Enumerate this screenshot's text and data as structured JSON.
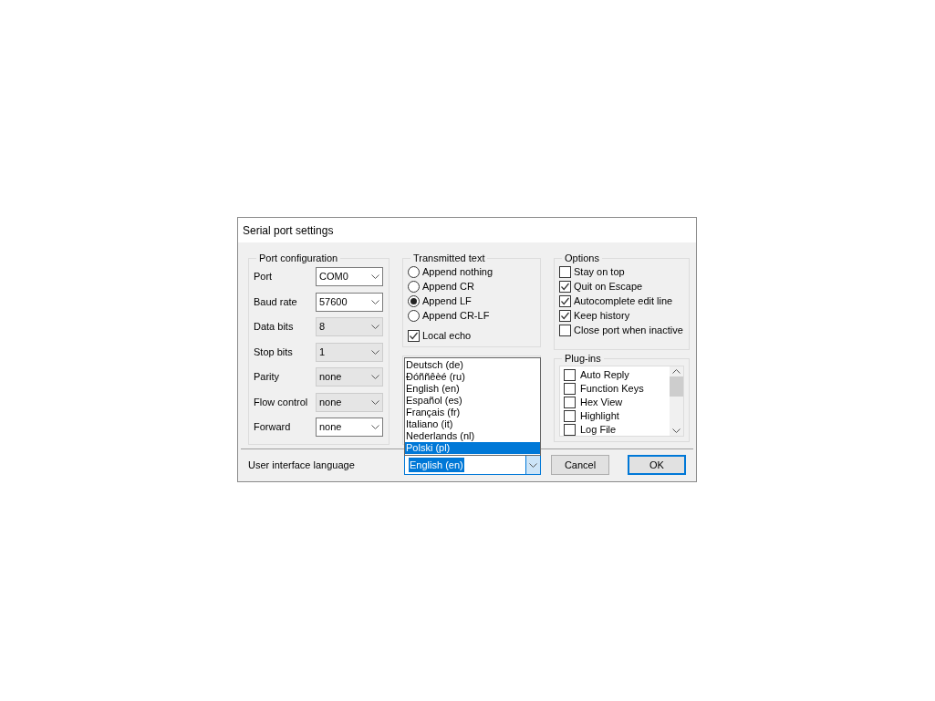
{
  "dialog": {
    "title": "Serial port settings"
  },
  "port_configuration": {
    "title": "Port configuration",
    "fields": [
      {
        "label": "Port",
        "value": "COM0",
        "disabled": false
      },
      {
        "label": "Baud rate",
        "value": "57600",
        "disabled": false
      },
      {
        "label": "Data bits",
        "value": "8",
        "disabled": true
      },
      {
        "label": "Stop bits",
        "value": "1",
        "disabled": true
      },
      {
        "label": "Parity",
        "value": "none",
        "disabled": true
      },
      {
        "label": "Flow control",
        "value": "none",
        "disabled": true
      },
      {
        "label": "Forward",
        "value": "none",
        "disabled": false
      }
    ]
  },
  "transmitted_text": {
    "title": "Transmitted text",
    "options": [
      {
        "label": "Append nothing",
        "selected": false
      },
      {
        "label": "Append CR",
        "selected": false
      },
      {
        "label": "Append LF",
        "selected": true
      },
      {
        "label": "Append CR-LF",
        "selected": false
      }
    ],
    "local_echo": {
      "label": "Local echo",
      "checked": true
    }
  },
  "options": {
    "title": "Options",
    "items": [
      {
        "label": "Stay on top",
        "checked": false
      },
      {
        "label": "Quit on Escape",
        "checked": true
      },
      {
        "label": "Autocomplete edit line",
        "checked": true
      },
      {
        "label": "Keep history",
        "checked": true
      },
      {
        "label": "Close port when inactive",
        "checked": false
      }
    ]
  },
  "plugins": {
    "title": "Plug-ins",
    "items": [
      {
        "label": "Auto Reply",
        "checked": false
      },
      {
        "label": "Function Keys",
        "checked": false
      },
      {
        "label": "Hex View",
        "checked": false
      },
      {
        "label": "Highlight",
        "checked": false
      },
      {
        "label": "Log File",
        "checked": false
      }
    ]
  },
  "language": {
    "label": "User interface language",
    "value": "English (en)",
    "list": [
      {
        "label": "Deutsch (de)",
        "highlighted": false
      },
      {
        "label": "Đóññêèé (ru)",
        "highlighted": false
      },
      {
        "label": "English (en)",
        "highlighted": false
      },
      {
        "label": "Español (es)",
        "highlighted": false
      },
      {
        "label": "Français (fr)",
        "highlighted": false
      },
      {
        "label": "Italiano (it)",
        "highlighted": false
      },
      {
        "label": "Nederlands (nl)",
        "highlighted": false
      },
      {
        "label": "Polski (pl)",
        "highlighted": true
      }
    ]
  },
  "buttons": [
    {
      "label": "Cancel",
      "default": false
    },
    {
      "label": "OK",
      "default": true
    }
  ]
}
